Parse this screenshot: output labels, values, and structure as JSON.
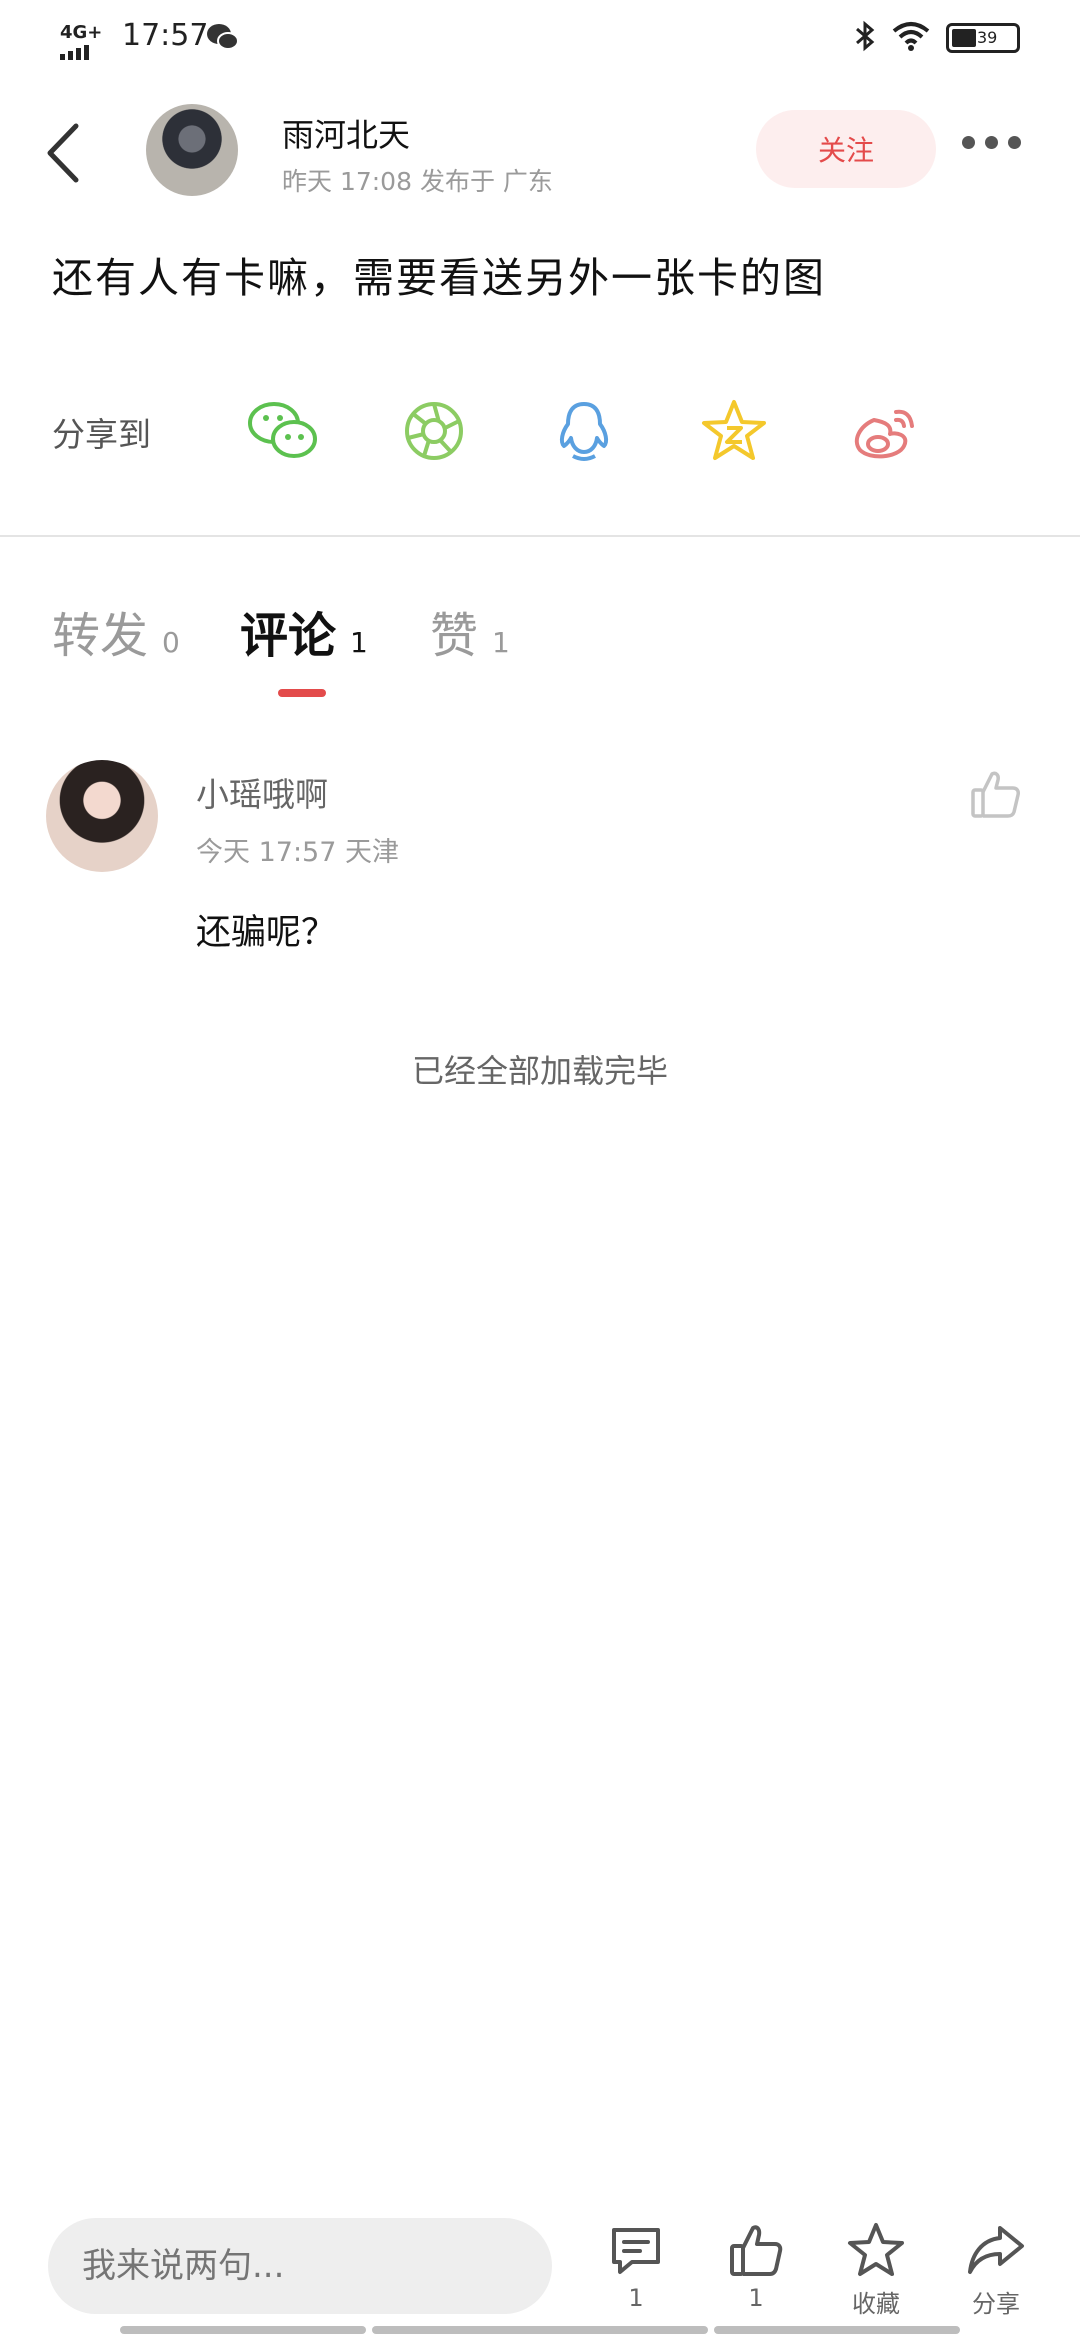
{
  "status_bar": {
    "network": "4G+",
    "time": "17:57",
    "battery_level": "39",
    "battery_fraction": 0.39
  },
  "post": {
    "author_name": "雨河北天",
    "meta": "昨天 17:08 发布于 广东",
    "follow_label": "关注",
    "text": "还有人有卡嘛，需要看送另外一张卡的图"
  },
  "share": {
    "label": "分享到",
    "targets": [
      {
        "icon": "wechat-icon",
        "color": "#5cc14f"
      },
      {
        "icon": "moments-icon",
        "color": "#8ccc63"
      },
      {
        "icon": "qq-icon",
        "color": "#5aa0e0"
      },
      {
        "icon": "qzone-icon",
        "color": "#f4c82c"
      },
      {
        "icon": "weibo-icon",
        "color": "#e57c7c"
      }
    ]
  },
  "tabs": [
    {
      "label": "转发",
      "count": "0",
      "active": false
    },
    {
      "label": "评论",
      "count": "1",
      "active": true
    },
    {
      "label": "赞",
      "count": "1",
      "active": false
    }
  ],
  "comment": {
    "user": "小瑶哦啊",
    "meta": "今天 17:57  天津",
    "text": "还骗呢？"
  },
  "end_text": "已经全部加载完毕",
  "bottom_bar": {
    "input_placeholder": "我来说两句...",
    "comment_count": "1",
    "like_count": "1",
    "favorite_label": "收藏",
    "share_label": "分享"
  },
  "colors": {
    "accent": "#e34b4b",
    "follow_bg": "#fdeeee"
  }
}
